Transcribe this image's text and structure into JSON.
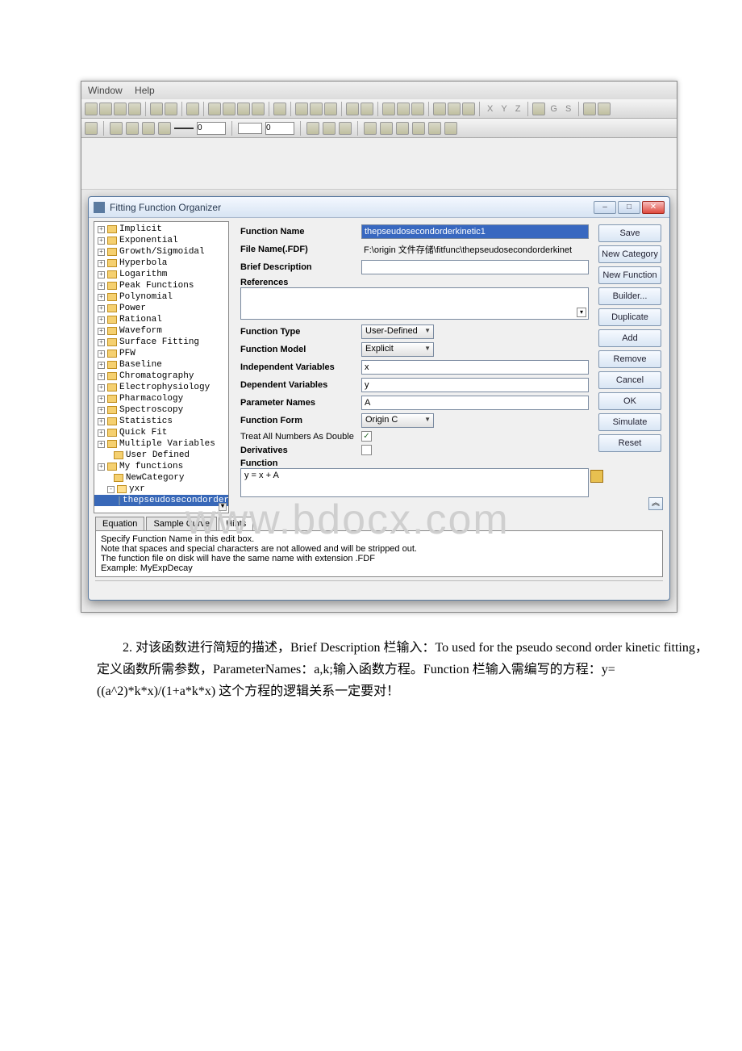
{
  "menu": {
    "window": "Window",
    "help": "Help"
  },
  "toolbar_axis": {
    "x": "X",
    "y": "Y",
    "z": "Z",
    "g": "G",
    "s": "S"
  },
  "line_sel": "0",
  "dialog": {
    "title": "Fitting Function Organizer",
    "tree": [
      "Implicit",
      "Exponential",
      "Growth/Sigmoidal",
      "Hyperbola",
      "Logarithm",
      "Peak Functions",
      "Polynomial",
      "Power",
      "Rational",
      "Waveform",
      "Surface Fitting",
      "PFW",
      "Baseline",
      "Chromatography",
      "Electrophysiology",
      "Pharmacology",
      "Spectroscopy",
      "Statistics",
      "Quick Fit",
      "Multiple Variables",
      "User Defined",
      "My functions",
      "NewCategory",
      "yxr"
    ],
    "tree_selected": "thepseudosecondorderkin",
    "labels": {
      "function_name": "Function Name",
      "file_name": "File Name(.FDF)",
      "brief_desc": "Brief Description",
      "references": "References",
      "function_type": "Function Type",
      "function_model": "Function Model",
      "indep_vars": "Independent Variables",
      "dep_vars": "Dependent Variables",
      "param_names": "Parameter Names",
      "function_form": "Function Form",
      "treat_double": "Treat All Numbers As Double",
      "derivatives": "Derivatives",
      "function": "Function"
    },
    "values": {
      "function_name": "thepseudosecondorderkinetic1",
      "file_name": "F:\\origin 文件存储\\fitfunc\\thepseudosecondorderkinet",
      "brief_desc": "",
      "function_type": "User-Defined",
      "function_model": "Explicit",
      "indep_vars": "x",
      "dep_vars": "y",
      "param_names": "A",
      "function_form": "Origin C",
      "function_body": "y = x + A"
    },
    "buttons": {
      "save": "Save",
      "new_category": "New Category",
      "new_function": "New Function",
      "builder": "Builder...",
      "duplicate": "Duplicate",
      "add": "Add",
      "remove": "Remove",
      "cancel": "Cancel",
      "ok": "OK",
      "simulate": "Simulate",
      "reset": "Reset"
    },
    "tabs": {
      "equation": "Equation",
      "sample_curve": "Sample Curve",
      "hints": "Hints"
    },
    "hint1": "Specify Function Name in this edit box.",
    "hint2": "Note that spaces and special characters are not allowed and will be stripped out.",
    "hint3": "The function file on disk will have the same name with extension .FDF",
    "hint4": "Example: MyExpDecay"
  },
  "watermark": "www.bdocx.com",
  "body_text": "2. 对该函数进行简短的描述，Brief Description 栏输入：To used for the pseudo second order kinetic fitting，定义函数所需参数，ParameterNames：a,k;输入函数方程。Function 栏输入需编写的方程：y=((a^2)*k*x)/(1+a*k*x) 这个方程的逻辑关系一定要对！"
}
